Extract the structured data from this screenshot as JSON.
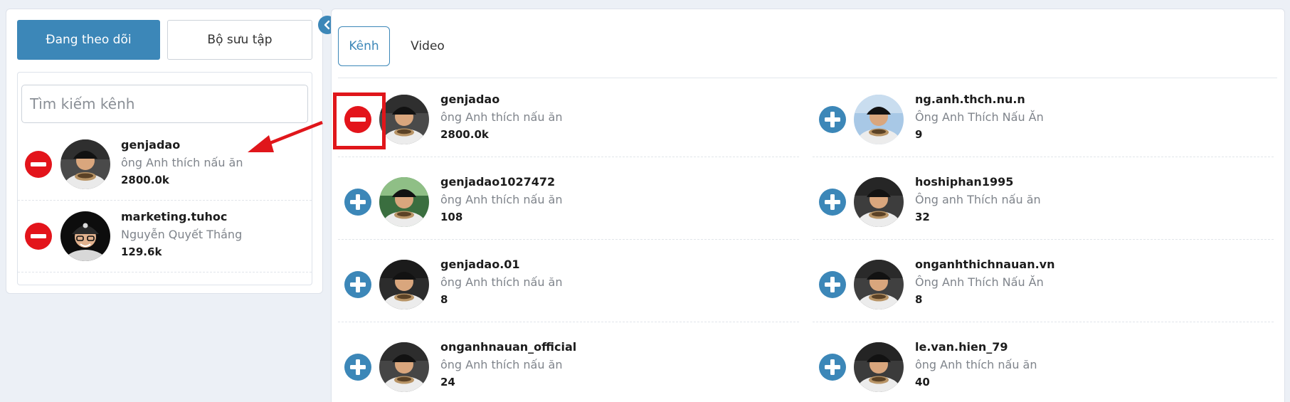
{
  "colors": {
    "accent": "#3c87b8",
    "remove": "#e3141b",
    "add": "#3c87b8",
    "highlight": "#e0161b"
  },
  "left_panel": {
    "tabs": {
      "following": "Đang theo dõi",
      "collection": "Bộ sưu tập"
    },
    "search": {
      "placeholder": "Tìm kiếm kênh",
      "value": ""
    },
    "followed": [
      {
        "name": "genjadao",
        "nickname": "ông Anh thích nấu ăn",
        "count": "2800.0k",
        "avatar": "man-cap-bowl",
        "action": "minus-icon"
      },
      {
        "name": "marketing.tuhoc",
        "nickname": "Nguyễn Quyết Thắng",
        "count": "129.6k",
        "avatar": "man-glasses-cap",
        "action": "minus-icon"
      }
    ]
  },
  "right_panel": {
    "tabs": {
      "channel": "Kênh",
      "video": "Video"
    },
    "results": [
      {
        "name": "genjadao",
        "nickname": "ông Anh thích nấu ăn",
        "count": "2800.0k",
        "action": "minus-icon"
      },
      {
        "name": "ng.anh.thch.nu.n",
        "nickname": "Ông Anh Thích Nấu Ăn",
        "count": "9",
        "action": "plus-icon"
      },
      {
        "name": "genjadao1027472",
        "nickname": "ông Anh thích nấu ăn",
        "count": "108",
        "action": "plus-icon"
      },
      {
        "name": "hoshiphan1995",
        "nickname": "Ông anh Thích nấu ăn",
        "count": "32",
        "action": "plus-icon"
      },
      {
        "name": "genjadao.01",
        "nickname": "ông Anh thích nấu ăn",
        "count": "8",
        "action": "plus-icon"
      },
      {
        "name": "onganhthichnauan.vn",
        "nickname": "Ông Anh Thích Nấu Ăn",
        "count": "8",
        "action": "plus-icon"
      },
      {
        "name": "onganhnauan_official",
        "nickname": "ông Anh thích nấu ăn",
        "count": "24",
        "action": "plus-icon"
      },
      {
        "name": "le.van.hien_79",
        "nickname": "ông Anh thích nấu ăn",
        "count": "40",
        "action": "plus-icon"
      }
    ]
  }
}
